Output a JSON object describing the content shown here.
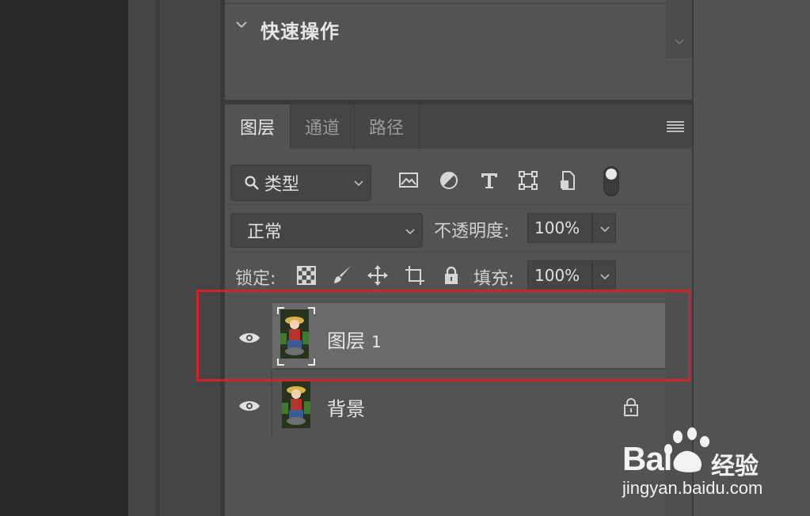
{
  "quick_actions": {
    "title": "快速操作"
  },
  "tabs": [
    {
      "label": "图层",
      "active": true
    },
    {
      "label": "通道",
      "active": false
    },
    {
      "label": "路径",
      "active": false
    }
  ],
  "filter": {
    "kind_label": "类型",
    "icons": [
      "image-filter-icon",
      "adjustment-filter-icon",
      "type-filter-icon",
      "shape-filter-icon",
      "smart-object-filter-icon"
    ]
  },
  "blend": {
    "mode": "正常",
    "opacity_label": "不透明度:",
    "opacity_value": "100%"
  },
  "lock": {
    "label": "锁定:",
    "fill_label": "填充:",
    "fill_value": "100%"
  },
  "layers": [
    {
      "name": "图层",
      "number": "1",
      "visible": true,
      "selected": true
    },
    {
      "name": "背景",
      "number": "",
      "visible": true,
      "locked": true
    }
  ],
  "watermark": {
    "brand": "Bai",
    "brand_du": "du",
    "cn": "经验",
    "url": "jingyan.baidu.com"
  },
  "colors": {
    "highlight": "#d0242a",
    "selected_row": "#6a6a6a"
  }
}
